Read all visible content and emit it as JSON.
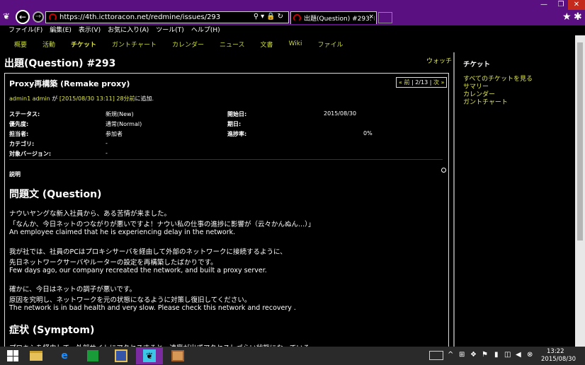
{
  "browser": {
    "url": "https://4th.icttoracon.net/redmine/issues/293",
    "tab_title": "出題(Question) #293: Pr...",
    "tab_close": "×",
    "window_min": "—",
    "window_max": "❐",
    "window_close": "✕"
  },
  "menubar": [
    "ファイル(F)",
    "編集(E)",
    "表示(V)",
    "お気に入り(A)",
    "ツール(T)",
    "ヘルプ(H)"
  ],
  "main_menu": {
    "items": [
      "概要",
      "活動",
      "チケット",
      "ガントチャート",
      "カレンダー",
      "ニュース",
      "文書",
      "Wiki",
      "ファイル"
    ],
    "selected": "チケット"
  },
  "issue": {
    "title": "出題(Question) #293",
    "watch": "ウォッチ",
    "subject": "Proxy再構築 (Remake proxy)",
    "pager": {
      "prev": "« 前",
      "position": "2/13",
      "next": "次 »"
    },
    "author": {
      "name": "admin1 admin",
      "ga": " が ",
      "date": "[2015/08/30 13:11]",
      "ago": "28分前",
      "suffix": "に追加."
    },
    "attributes": {
      "status_label": "ステータス:",
      "status": "新規(New)",
      "priority_label": "優先度:",
      "priority": "通常(Normal)",
      "assignee_label": "担当者:",
      "assignee": "参加者",
      "category_label": "カテゴリ:",
      "category": "-",
      "version_label": "対象バージョン:",
      "version": "-",
      "start_label": "開始日:",
      "start": "2015/08/30",
      "due_label": "期日:",
      "due": "",
      "progress_label": "進捗率:",
      "progress": "0%"
    },
    "description_label": "説明",
    "description": {
      "h_question": "問題文 (Question)",
      "p1": "ナウいヤングな新入社員から、ある苦情が来ました。",
      "p2": "「なんか、今日ネットのつながりが悪いですよ！ナウい私の仕事の進捗に影響が（云々かんぬん...）」",
      "p3": "An employee claimed that he is experiencing delay in the network.",
      "p4": "我が社では、社員のPCはプロキシサーバを経由して外部のネットワークに接続するように、",
      "p5": "先日ネットワークサーバやルーターの設定を再構築したばかりです。",
      "p6": "Few days ago, our company recreated the network, and built a proxy server.",
      "p7": "確かに、今日はネットの調子が悪いです。",
      "p8": "原因を究明し、ネットワークを元の状態になるように対策し復旧してください。",
      "p9": "The network is in bad health and very slow. Please check this network and recovery .",
      "h_symptom": "症状 (Symptom)",
      "p10": "プロキシを経由して、外部サイトにアクセスすると、速度が出ずアクセスしづらい状態になっている。"
    }
  },
  "sidebar": {
    "title": "チケット",
    "links": [
      "すべてのチケットを見る",
      "サマリー",
      "カレンダー",
      "ガントチャート"
    ]
  },
  "taskbar": {
    "time": "13:22",
    "date": "2015/08/30"
  }
}
